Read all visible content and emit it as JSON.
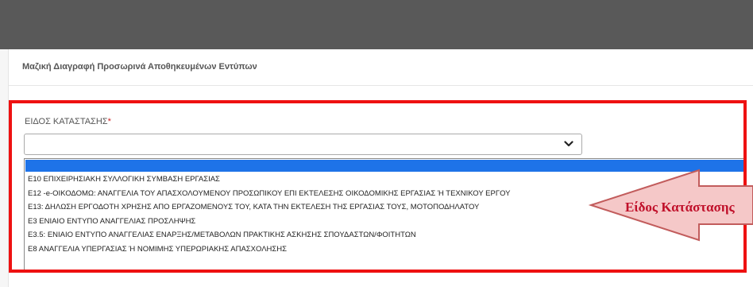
{
  "header": {
    "title": "Μαζική Διαγραφή Προσωρινά Αποθηκευμένων Εντύπων"
  },
  "form": {
    "status_type_label": "ΕΙΔΟΣ ΚΑΤΑΣΤΑΣΗΣ",
    "required_marker": "*",
    "selected_value": ""
  },
  "dropdown": {
    "options": [
      "",
      "Ε10 ΕΠΙΧΕΙΡΗΣΙΑΚΗ ΣΥΛΛΟΓΙΚΗ ΣΥΜΒΑΣΗ ΕΡΓΑΣΙΑΣ",
      "Ε12 -e-ΟΙΚΟΔΟΜΩ: ΑΝΑΓΓΕΛΙΑ ΤΟΥ ΑΠΑΣΧΟΛΟΥΜΕΝΟΥ ΠΡΟΣΩΠΙΚΟΥ ΕΠΙ ΕΚΤΕΛΕΣΗΣ ΟΙΚΟΔΟΜΙΚΗΣ ΕΡΓΑΣΙΑΣ Ή ΤΕΧΝΙΚΟΥ ΕΡΓΟΥ",
      "Ε13: ΔΗΛΩΣΗ ΕΡΓΟΔΟΤΗ ΧΡΗΣΗΣ ΑΠΟ ΕΡΓΑΖΟΜΕΝΟΥΣ ΤΟΥ, ΚΑΤΑ ΤΗΝ ΕΚΤΕΛΕΣΗ ΤΗΣ ΕΡΓΑΣΙΑΣ ΤΟΥΣ, ΜΟΤΟΠΟΔΗΛΑΤΟΥ",
      "Ε3 ΕΝΙΑΙΟ ΕΝΤΥΠΟ ΑΝΑΓΓΕΛΙΑΣ ΠΡΟΣΛΗΨΗΣ",
      "Ε3.5: ΕΝΙΑΙΟ ΕΝΤΥΠΟ ΑΝΑΓΓΕΛΙΑΣ ΕΝΑΡΞΗΣ/ΜΕΤΑΒΟΛΩΝ ΠΡΑΚΤΙΚΗΣ ΑΣΚΗΣΗΣ ΣΠΟΥΔΑΣΤΩΝ/ΦΟΙΤΗΤΩΝ",
      "Ε8 ΑΝΑΓΓΕΛΙΑ ΥΠΕΡΓΑΣΙΑΣ Ή ΝΟΜΙΜΗΣ ΥΠΕΡΩΡΙΑΚΗΣ ΑΠΑΣΧΟΛΗΣΗΣ"
    ]
  },
  "annotation": {
    "callout_text": "Είδος Κατάστασης",
    "highlight_color": "#ee1111",
    "arrow_fill": "#f5c8c8",
    "arrow_stroke": "#c25c5c",
    "text_color": "#c0102a"
  },
  "colors": {
    "topbar": "#595959",
    "selected_option": "#1e73e8"
  }
}
